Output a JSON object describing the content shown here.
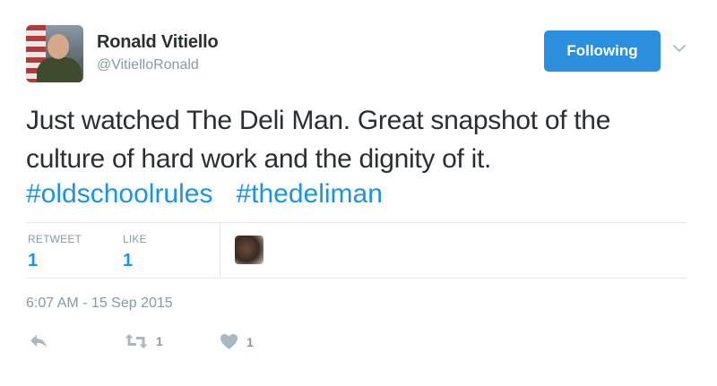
{
  "user": {
    "name": "Ronald Vitiello",
    "handle": "@VitielloRonald"
  },
  "follow_button": {
    "label": "Following"
  },
  "tweet": {
    "text": "Just watched The Deli Man. Great snapshot of the culture of hard work and the dignity of it.",
    "hashtags": [
      "#oldschoolrules",
      "#thedeliman"
    ]
  },
  "stats": {
    "retweet_label": "RETWEET",
    "retweet_count": "1",
    "like_label": "LIKE",
    "like_count": "1"
  },
  "timestamp": "6:07 AM - 15 Sep 2015",
  "actions": {
    "reply_icon": "reply-icon",
    "retweet_icon": "retweet-icon",
    "retweet_count": "1",
    "like_icon": "heart-icon",
    "like_count": "1"
  },
  "colors": {
    "accent": "#1b95e0",
    "button": "#2b8fdd",
    "muted": "#8899a6"
  }
}
